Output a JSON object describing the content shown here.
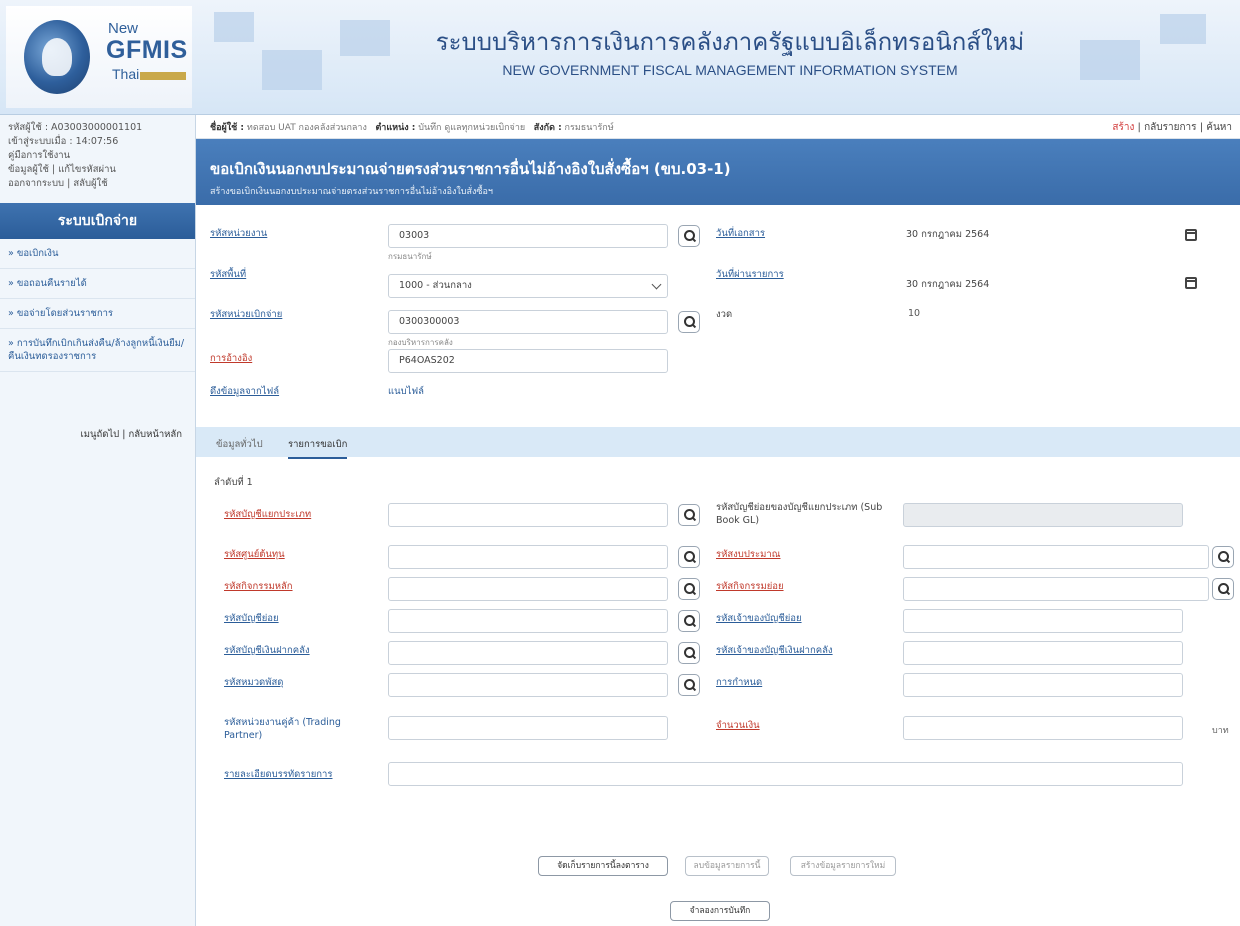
{
  "header": {
    "logo_new": "New",
    "logo_gfmis": "GFMIS",
    "logo_thai": "Thai",
    "title_th": "ระบบบริหารการเงินการคลังภาครัฐแบบอิเล็กทรอนิกส์ใหม่",
    "title_en": "NEW GOVERNMENT FISCAL MANAGEMENT INFORMATION SYSTEM"
  },
  "sidebar": {
    "user_code": "รหัสผู้ใช้ : A03003000001101",
    "login_time": "เข้าสู่ระบบเมื่อ : 14:07:56",
    "manual": "คู่มือการใช้งาน",
    "user_data": "ข้อมูลผู้ใช้",
    "change_password": "แก้ไขรหัสผ่าน",
    "logout": "ออกจากระบบ",
    "switch_user": "สลับผู้ใช้",
    "section_title": "ระบบเบิกจ่าย",
    "menu": [
      "» ขอเบิกเงิน",
      "» ขอถอนคืนรายได้",
      "» ขอจ่ายโดยส่วนราชการ",
      "» การบันทึกเบิกเกินส่งคืน/ล้างลูกหนี้เงินยืม/คืนเงินทดรองราชการ"
    ],
    "main_menu": "เมนูถัดไป",
    "home": "กลับหน้าหลัก"
  },
  "topbar": {
    "user_label": "ชื่อผู้ใช้ :",
    "user_value": "ทดสอบ UAT กองคลังส่วนกลาง",
    "position_label": "ตำแหน่ง :",
    "position_value": "บันทึก ดูแลทุกหน่วยเบิกจ่าย",
    "affiliation_label": "สังกัด :",
    "affiliation_value": "กรมธนารักษ์",
    "create": "สร้าง",
    "back_list": "กลับรายการ",
    "search": "ค้นหา"
  },
  "page": {
    "title": "ขอเบิกเงินนอกงบประมาณจ่ายตรงส่วนราชการอื่นไม่อ้างอิงใบสั่งซื้อฯ (ขบ.03-1)",
    "subtitle": "สร้างขอเบิกเงินนอกงบประมาณจ่ายตรงส่วนราชการอื่นไม่อ้างอิงใบสั่งซื้อฯ"
  },
  "form": {
    "agency_code_label": "รหัสหน่วยงาน",
    "agency_code_value": "03003",
    "agency_name": "กรมธนารักษ์",
    "area_code_label": "รหัสพื้นที่",
    "area_code_value": "1000 - ส่วนกลาง",
    "disb_unit_label": "รหัสหน่วยเบิกจ่าย",
    "disb_unit_value": "0300300003",
    "disb_unit_name": "กองบริหารการคลัง",
    "reference_label": "การอ้างอิง",
    "reference_value": "P64OAS202",
    "pull_file_label": "ดึงข้อมูลจากไฟล์",
    "pull_file_value": "แนบไฟล์",
    "doc_date_label": "วันที่เอกสาร",
    "doc_date_value": "30 กรกฎาคม 2564",
    "post_date_label": "วันที่ผ่านรายการ",
    "post_date_value": "30 กรกฎาคม 2564",
    "period_label": "งวด",
    "period_value": "10"
  },
  "tabs": [
    "ข้อมูลทั่วไป",
    "รายการขอเบิก"
  ],
  "detail": {
    "seq_label": "ลำดับที่ 1",
    "gl_label": "รหัสบัญชีแยกประเภท",
    "sub_gl_label": "รหัสบัญชีย่อยของบัญชีแยกประเภท (Sub Book GL)",
    "cost_center_label": "รหัสศูนย์ต้นทุน",
    "budget_label": "รหัสงบประมาณ",
    "main_activity_label": "รหัสกิจกรรมหลัก",
    "sub_activity_label": "รหัสกิจกรรมย่อย",
    "sub_account_label": "รหัสบัญชีย่อย",
    "sub_account_owner_label": "รหัสเจ้าของบัญชีย่อย",
    "deposit_account_label": "รหัสบัญชีเงินฝากคลัง",
    "deposit_owner_label": "รหัสเจ้าของบัญชีเงินฝากคลัง",
    "material_group_label": "รหัสหมวดพัสดุ",
    "assignment_label": "การกำหนด",
    "trading_partner_label": "รหัสหน่วยงานคู่ค้า (Trading Partner)",
    "amount_label": "จำนวนเงิน",
    "amount_unit": "บาท",
    "description_label": "รายละเอียดบรรทัดรายการ"
  },
  "buttons": {
    "save_item": "จัดเก็บรายการนี้ลงตาราง",
    "delete_item": "ลบข้อมูลรายการนี้",
    "new_item": "สร้างข้อมูลรายการใหม่",
    "simulate": "จำลองการบันทึก"
  }
}
